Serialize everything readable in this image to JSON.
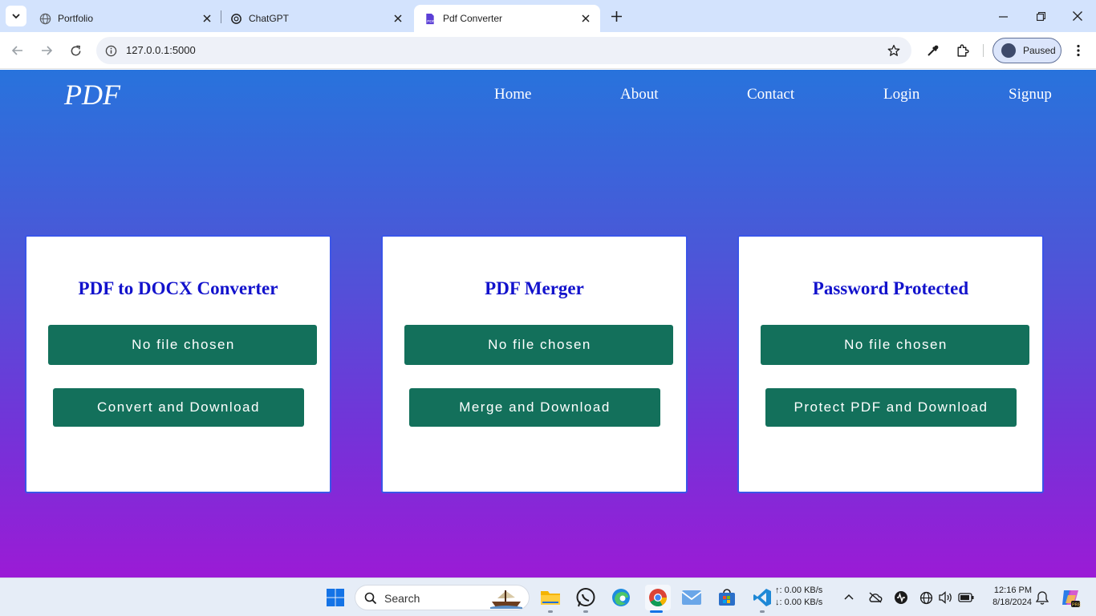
{
  "browser": {
    "tabs": [
      {
        "title": "Portfolio",
        "icon": "globe-icon"
      },
      {
        "title": "ChatGPT",
        "icon": "chatgpt-icon"
      },
      {
        "title": "Pdf Converter",
        "icon": "pdf-icon",
        "active": true
      }
    ],
    "url": "127.0.0.1:5000",
    "profile_label": "Paused"
  },
  "site": {
    "logo": "PDF",
    "nav": [
      "Home",
      "About",
      "Contact",
      "Login",
      "Signup"
    ],
    "cards": [
      {
        "title": "PDF to DOCX Converter",
        "file_label": "No file chosen",
        "action": "Convert and Download"
      },
      {
        "title": "PDF Merger",
        "file_label": "No file chosen",
        "action": "Merge and Download"
      },
      {
        "title": "Password Protected",
        "file_label": "No file chosen",
        "action": "Protect PDF and Download"
      }
    ],
    "colors": {
      "heading": "#1212cc",
      "button": "#13705b",
      "gradient_top": "#2873dc",
      "gradient_bottom": "#9b1bd6"
    }
  },
  "taskbar": {
    "search_label": "Search",
    "upload_speed": "↑: 0.00 KB/s",
    "download_speed": "↓: 0.00 KB/s",
    "time": "12:16 PM",
    "date": "8/18/2024"
  }
}
